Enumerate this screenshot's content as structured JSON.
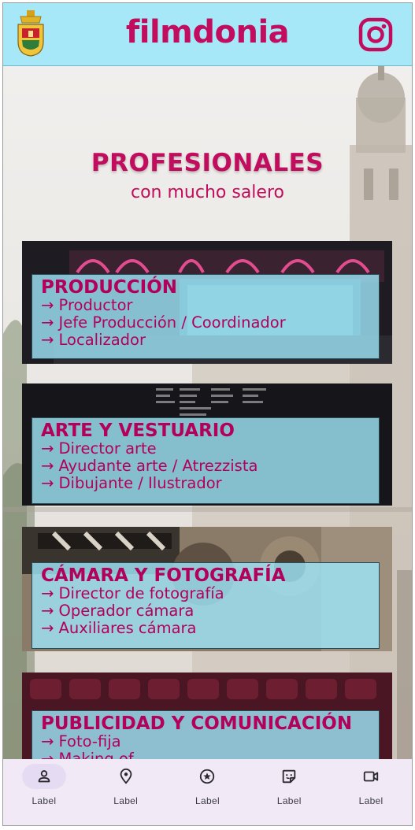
{
  "header": {
    "brand": "filmdonia",
    "crest_icon": "town-crest-icon",
    "social_icon": "instagram-icon"
  },
  "hero": {
    "title": "PROFESIONALES",
    "subtitle": "con mucho salero"
  },
  "categories": [
    {
      "title": "PRODUCCIÓN",
      "items": [
        "→ Productor",
        "→ Jefe Producción / Coordinador",
        "→ Localizador"
      ]
    },
    {
      "title": "ARTE Y VESTUARIO",
      "items": [
        "→ Director arte",
        "→ Ayudante arte / Atrezzista",
        "→ Dibujante / Ilustrador"
      ]
    },
    {
      "title": "CÁMARA Y FOTOGRAFÍA",
      "items": [
        "→ Director de fotografía",
        "→ Operador cámara",
        "→ Auxiliares cámara"
      ]
    },
    {
      "title": "PUBLICIDAD Y COMUNICACIÓN",
      "items": [
        "→ Foto-fija",
        "→ Making of"
      ]
    }
  ],
  "bottom_nav": [
    {
      "label": "Label",
      "icon": "person-icon",
      "active": true
    },
    {
      "label": "Label",
      "icon": "location-pin-icon",
      "active": false
    },
    {
      "label": "Label",
      "icon": "star-circle-icon",
      "active": false
    },
    {
      "label": "Label",
      "icon": "sticker-icon",
      "active": false
    },
    {
      "label": "Label",
      "icon": "videocam-icon",
      "active": false
    }
  ],
  "colors": {
    "brand": "#c20d5e",
    "header_bg": "#a7e8f8",
    "panel_bg": "#9ee4f6",
    "nav_bg": "#f1eaf6",
    "nav_active": "#e5dcf3"
  }
}
